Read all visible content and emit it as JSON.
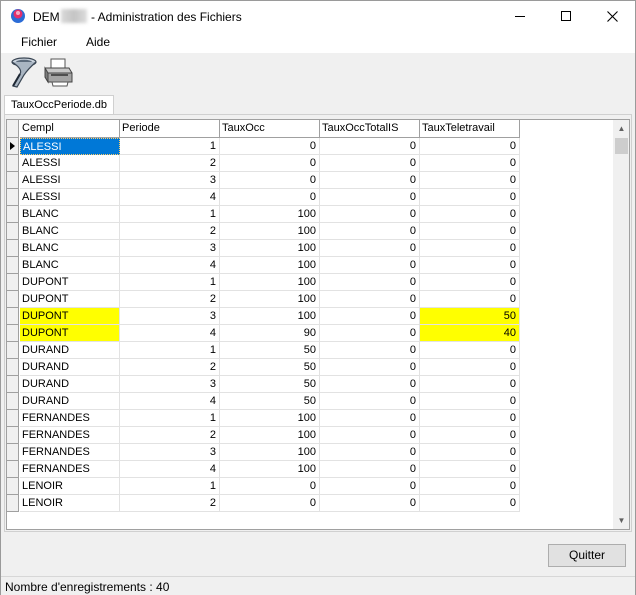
{
  "window": {
    "title_prefix": "DEM",
    "title_suffix": " - Administration des Fichiers",
    "minimize_icon": "minimize-icon",
    "maximize_icon": "maximize-icon",
    "close_icon": "close-icon"
  },
  "menu": {
    "items": [
      "Fichier",
      "Aide"
    ]
  },
  "toolbar": {
    "tools": [
      "filter-funnel-icon",
      "printer-icon"
    ]
  },
  "tab": {
    "label": "TauxOccPeriode.db"
  },
  "grid": {
    "columns": [
      "Cempl",
      "Periode",
      "TauxOcc",
      "TauxOccTotalIS",
      "TauxTeletravail"
    ],
    "rows": [
      [
        "ALESSI",
        "1",
        "0",
        "0",
        "0"
      ],
      [
        "ALESSI",
        "2",
        "0",
        "0",
        "0"
      ],
      [
        "ALESSI",
        "3",
        "0",
        "0",
        "0"
      ],
      [
        "ALESSI",
        "4",
        "0",
        "0",
        "0"
      ],
      [
        "BLANC",
        "1",
        "100",
        "0",
        "0"
      ],
      [
        "BLANC",
        "2",
        "100",
        "0",
        "0"
      ],
      [
        "BLANC",
        "3",
        "100",
        "0",
        "0"
      ],
      [
        "BLANC",
        "4",
        "100",
        "0",
        "0"
      ],
      [
        "DUPONT",
        "1",
        "100",
        "0",
        "0"
      ],
      [
        "DUPONT",
        "2",
        "100",
        "0",
        "0"
      ],
      [
        "DUPONT",
        "3",
        "100",
        "0",
        "50"
      ],
      [
        "DUPONT",
        "4",
        "90",
        "0",
        "40"
      ],
      [
        "DURAND",
        "1",
        "50",
        "0",
        "0"
      ],
      [
        "DURAND",
        "2",
        "50",
        "0",
        "0"
      ],
      [
        "DURAND",
        "3",
        "50",
        "0",
        "0"
      ],
      [
        "DURAND",
        "4",
        "50",
        "0",
        "0"
      ],
      [
        "FERNANDES",
        "1",
        "100",
        "0",
        "0"
      ],
      [
        "FERNANDES",
        "2",
        "100",
        "0",
        "0"
      ],
      [
        "FERNANDES",
        "3",
        "100",
        "0",
        "0"
      ],
      [
        "FERNANDES",
        "4",
        "100",
        "0",
        "0"
      ],
      [
        "LENOIR",
        "1",
        "0",
        "0",
        "0"
      ],
      [
        "LENOIR",
        "2",
        "0",
        "0",
        "0"
      ]
    ],
    "highlighted_rows": [
      10,
      11
    ],
    "highlighted_columns": [
      0,
      4
    ],
    "highlight_color": "#ffff00",
    "selected_row": 0,
    "selection_color": "#0078d7"
  },
  "buttons": {
    "quit_label": "Quitter"
  },
  "status": {
    "text": "Nombre d'enregistrements : 40"
  }
}
